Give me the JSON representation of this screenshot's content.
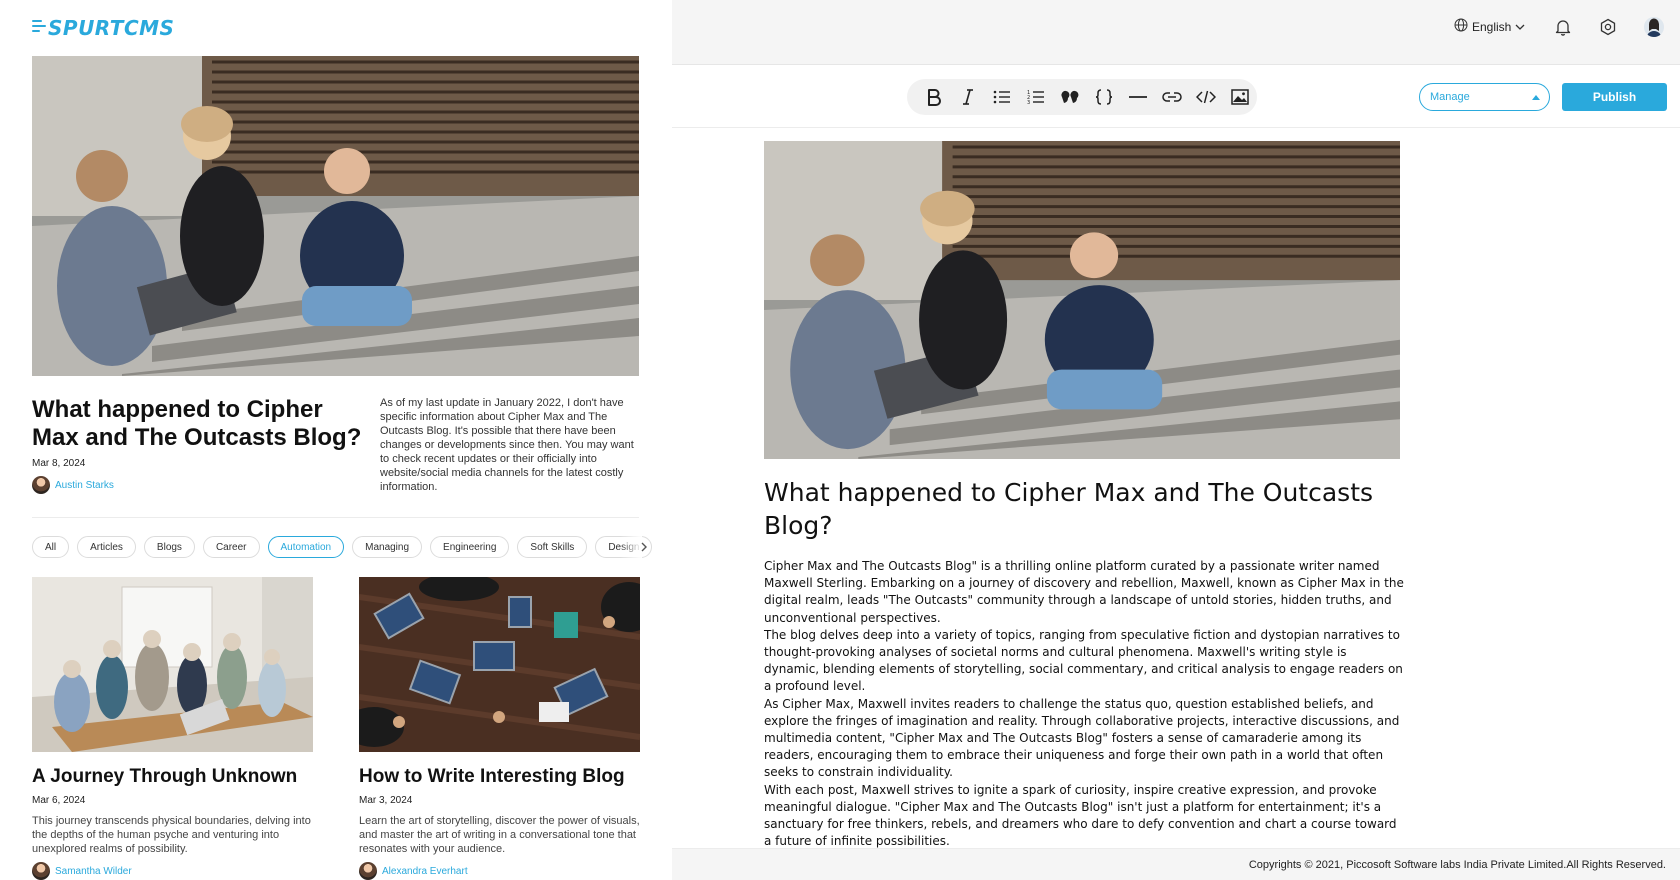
{
  "brand": {
    "logo_text": "SPURTCMS",
    "color": "#2aa9dc"
  },
  "featured": {
    "title": "What happened to Cipher Max and The Outcasts Blog?",
    "date": "Mar 8, 2024",
    "author": "Austin Starks",
    "description": "As of my last update in January 2022, I don't have specific information about Cipher Max and The Outcasts Blog. It's possible that there have been changes or developments since then. You may want to check recent updates or their officially into website/social media channels for the latest costly information."
  },
  "categories": {
    "items": [
      "All",
      "Articles",
      "Blogs",
      "Career",
      "Automation",
      "Managing",
      "Engineering",
      "Soft Skills",
      "Design"
    ],
    "active": "Automation"
  },
  "cards": [
    {
      "title": "A Journey Through Unknown",
      "date": "Mar 6, 2024",
      "description": "This journey transcends physical boundaries, delving into the depths of the human psyche and venturing into unexplored realms of possibility.",
      "author": "Samantha Wilder"
    },
    {
      "title": "How to Write Interesting Blog",
      "date": "Mar 3, 2024",
      "description": "Learn the art of storytelling, discover the power of visuals, and master the art of writing in a conversational tone that resonates with your audience.",
      "author": "Alexandra Everhart"
    }
  ],
  "topbar": {
    "language": "English",
    "icons": [
      "globe-icon",
      "chevron-down-icon",
      "bell-icon",
      "settings-icon",
      "user-avatar"
    ]
  },
  "editor": {
    "toolbar": [
      "bold",
      "italic",
      "bulleted-list",
      "numbered-list",
      "quote",
      "code-block",
      "horizontal-rule",
      "link",
      "inline-code",
      "image"
    ],
    "status_select": "Manage",
    "publish_label": "Publish",
    "title": "What happened to Cipher Max and The Outcasts Blog?",
    "paragraphs": [
      "Cipher Max and The Outcasts Blog\" is a thrilling online platform curated by a passionate writer named Maxwell Sterling. Embarking on a journey of discovery and rebellion, Maxwell, known as Cipher Max in the digital realm, leads \"The Outcasts\" community through a landscape of untold stories, hidden truths, and unconventional perspectives.",
      "The blog delves deep into a variety of topics, ranging from speculative fiction and dystopian narratives to thought-provoking analyses of societal norms and cultural phenomena. Maxwell's writing style is dynamic, blending elements of storytelling, social commentary, and critical analysis to engage readers on a profound level.",
      "As Cipher Max, Maxwell invites readers to challenge the status quo, question established beliefs, and explore the fringes of imagination and reality. Through collaborative projects, interactive discussions, and multimedia content, \"Cipher Max and The Outcasts Blog\" fosters a sense of camaraderie among its readers, encouraging them to embrace their uniqueness and forge their own path in a world that often seeks to constrain individuality.",
      "With each post, Maxwell strives to ignite a spark of curiosity, inspire creative expression, and provoke meaningful dialogue. \"Cipher Max and The Outcasts Blog\" isn't just a platform for entertainment; it's a sanctuary for free thinkers, rebels, and dreamers who dare to defy convention and chart a course toward a future of infinite possibilities."
    ]
  },
  "footer": {
    "text": "Copyrights © 2021, Piccosoft Software labs India Private Limited.All Rights Reserved."
  }
}
